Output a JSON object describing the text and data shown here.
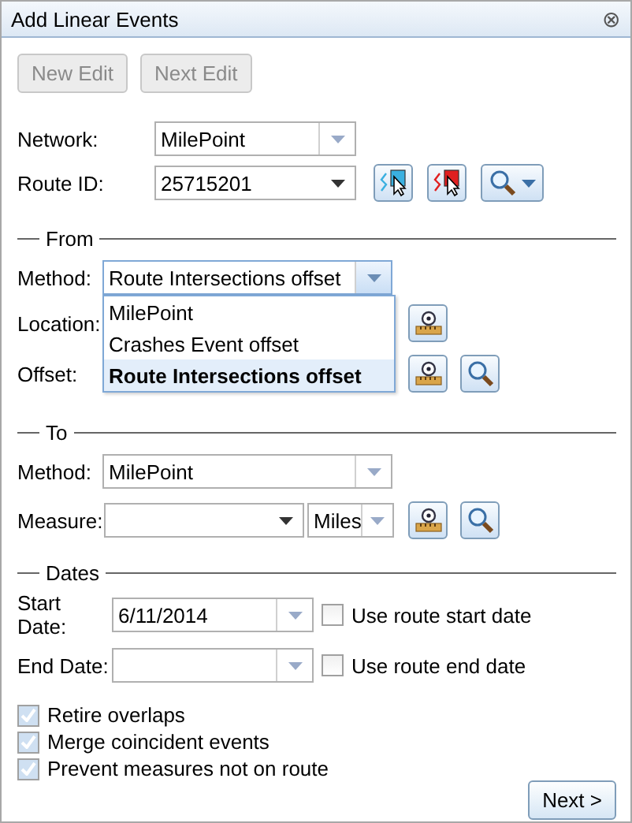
{
  "window": {
    "title": "Add Linear Events",
    "close": "⊗"
  },
  "toolbar": [
    {
      "label": "New Edit",
      "disabled": true
    },
    {
      "label": "Next Edit",
      "disabled": true
    }
  ],
  "network": {
    "label": "Network:",
    "value": "MilePoint"
  },
  "route_id": {
    "label": "Route ID:",
    "value": "25715201"
  },
  "from": {
    "legend": "From",
    "method": {
      "label": "Method:",
      "value": "Route Intersections offset",
      "expanded": true,
      "options": [
        {
          "label": "MilePoint",
          "selected": false
        },
        {
          "label": "Crashes Event offset",
          "selected": false
        },
        {
          "label": "Route Intersections offset",
          "selected": true
        }
      ]
    },
    "location": {
      "label": "Location:"
    },
    "offset": {
      "label": "Offset:"
    }
  },
  "to": {
    "legend": "To",
    "method": {
      "label": "Method:",
      "value": "MilePoint"
    },
    "measure": {
      "label": "Measure:",
      "units": "Miles"
    }
  },
  "dates": {
    "legend": "Dates",
    "start": {
      "label": "Start Date:",
      "value": "6/11/2014",
      "option": "Use route start date",
      "checked": false
    },
    "end": {
      "label": "End Date:",
      "option": "Use route end date",
      "checked": false
    }
  },
  "options": [
    {
      "label": "Retire overlaps",
      "checked": true
    },
    {
      "label": "Merge coincident events",
      "checked": true
    },
    {
      "label": "Prevent measures not on route",
      "checked": true
    }
  ],
  "next_button": "Next >"
}
